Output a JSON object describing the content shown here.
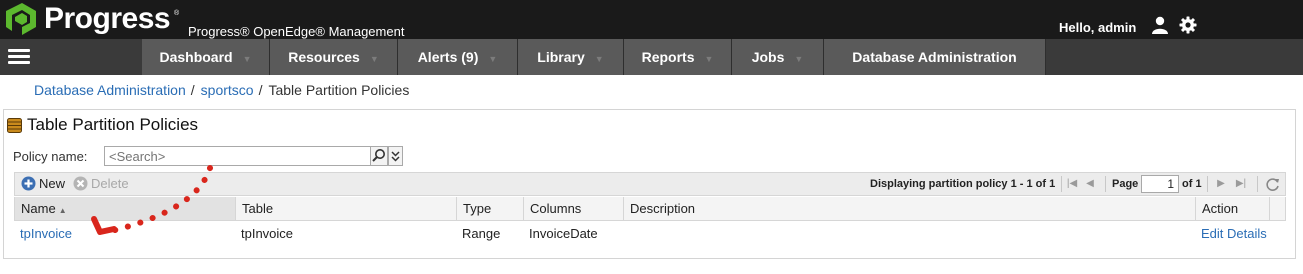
{
  "brand": {
    "name": "Progress",
    "reg_mark": "®",
    "product": "Progress® OpenEdge® Management"
  },
  "header": {
    "greeting": "Hello, admin",
    "user_icon": "user-icon",
    "settings_icon": "gear-icon"
  },
  "nav": {
    "menu_icon": "hamburger-icon",
    "items": [
      {
        "label": "Dashboard"
      },
      {
        "label": "Resources"
      },
      {
        "label": "Alerts (9)"
      },
      {
        "label": "Library"
      },
      {
        "label": "Reports"
      },
      {
        "label": "Jobs"
      },
      {
        "label": "Database Administration"
      }
    ]
  },
  "breadcrumb": {
    "items": [
      {
        "label": "Database Administration"
      },
      {
        "label": "sportsco"
      }
    ],
    "separator": "/",
    "current": "Table Partition Policies"
  },
  "panel": {
    "title": "Table Partition Policies",
    "title_icon": "database-icon"
  },
  "filter": {
    "label": "Policy name:",
    "placeholder": "<Search>"
  },
  "toolbar": {
    "new_label": "New",
    "delete_label": "Delete",
    "paging_text": "Displaying partition policy 1 - 1 of 1",
    "page_label": "Page",
    "page_value": "1",
    "page_of": "of 1"
  },
  "grid": {
    "columns": [
      "Name",
      "Table",
      "Type",
      "Columns",
      "Description",
      "Action"
    ],
    "sorted_column": "Name",
    "rows": [
      {
        "name": "tpInvoice",
        "table": "tpInvoice",
        "type": "Range",
        "columns": "InvoiceDate",
        "description": "",
        "action": "Edit Details"
      }
    ]
  },
  "colors": {
    "brand_green": "#5cb82e",
    "header_bg": "#1a1a1a",
    "nav_bg": "#5a5a5a",
    "link": "#2a6db5",
    "annotation_red": "#d9261c"
  }
}
